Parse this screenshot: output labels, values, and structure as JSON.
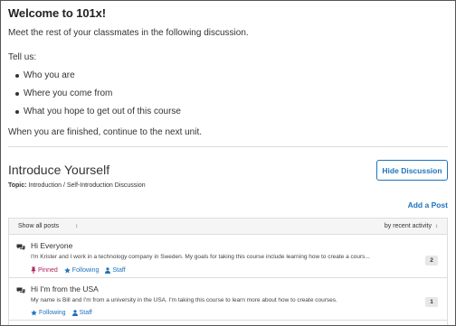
{
  "intro": {
    "heading": "Welcome to 101x!",
    "lead": "Meet the rest of your classmates in the following discussion.",
    "tell_us": "Tell us:",
    "bullets": [
      "Who you are",
      "Where you come from",
      "What you hope to get out of this course"
    ],
    "finish": "When you are finished, continue to the next unit."
  },
  "discussion": {
    "title": "Introduce Yourself",
    "topic_label": "Topic:",
    "topic_value": "Introduction / Self-Introduction Discussion",
    "hide_button": "Hide Discussion",
    "add_post": "Add a Post",
    "filter": "Show all posts",
    "sort": "by recent activity",
    "threads": [
      {
        "title": "Hi Everyone",
        "snippet": "I'm Krister and I work in a technology company in Sweden. My goals for taking this course include learning how to create a cours...",
        "pinned": "Pinned",
        "following": "Following",
        "staff": "Staff",
        "count": "2"
      },
      {
        "title": "Hi I'm from the USA",
        "snippet": "My name is Bill and I'm from a university in the USA. I'm taking this course to learn more about how to create courses.",
        "following": "Following",
        "staff": "Staff",
        "count": "1"
      }
    ]
  },
  "colors": {
    "accent": "#1e73be",
    "pinned": "#b0245b"
  },
  "icons": {
    "thread": "comments-icon",
    "pin": "pin-icon",
    "following": "star-icon",
    "staff": "user-icon",
    "dropdown": "updown-caret-icon"
  }
}
